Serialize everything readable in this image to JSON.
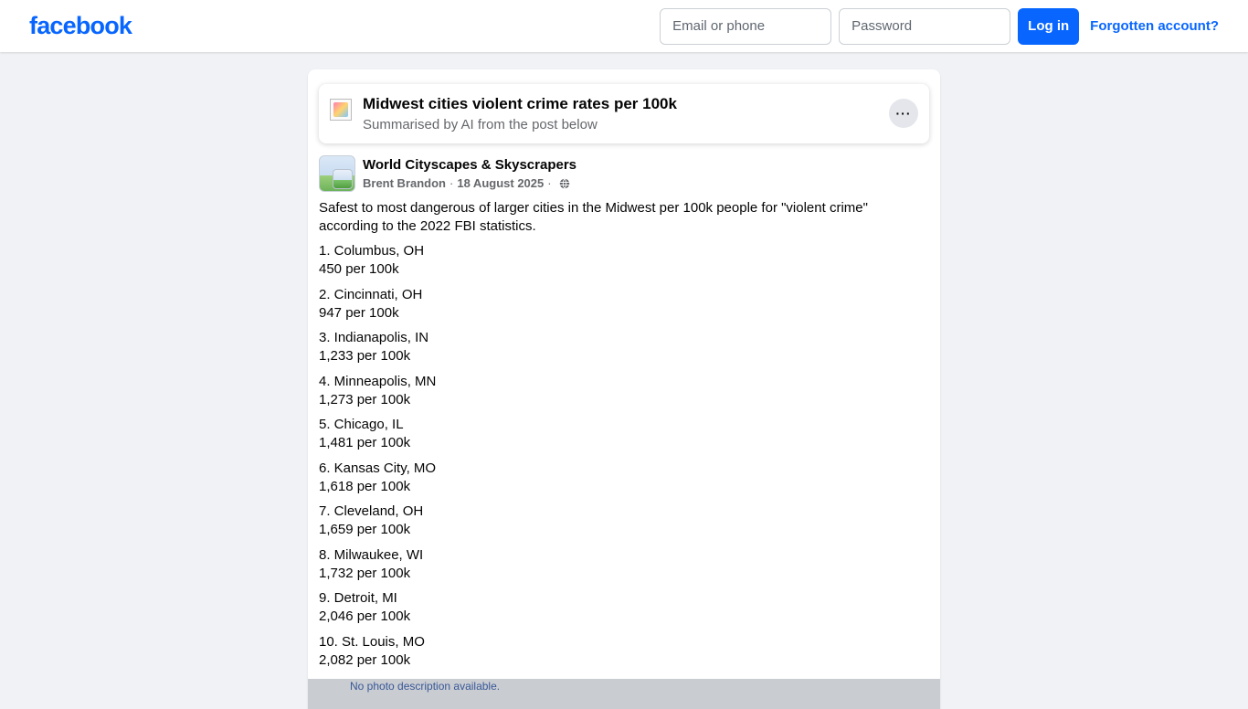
{
  "header": {
    "logo": "facebook",
    "email_placeholder": "Email or phone",
    "password_placeholder": "Password",
    "login_label": "Log in",
    "forgot_label": "Forgotten account?"
  },
  "summary": {
    "title": "Midwest cities violent crime rates per 100k",
    "subtitle": "Summarised by AI from the post below",
    "more_icon": "more-horizontal-icon",
    "more_label": "···"
  },
  "post": {
    "page_name": "World Cityscapes & Skyscrapers",
    "author": "Brent Brandon",
    "date": "18 August 2025",
    "privacy_icon": "globe-icon",
    "intro": "Safest to most dangerous of larger cities in the Midwest per 100k people for \"violent crime\" according to the 2022 FBI statistics.",
    "items": [
      {
        "city": "1. Columbus, OH",
        "rate": "450 per 100k"
      },
      {
        "city": "2. Cincinnati, OH",
        "rate": "947 per 100k"
      },
      {
        "city": "3. Indianapolis, IN",
        "rate": "1,233 per 100k"
      },
      {
        "city": "4. Minneapolis, MN",
        "rate": "1,273 per 100k"
      },
      {
        "city": "5. Chicago, IL",
        "rate": "1,481 per 100k"
      },
      {
        "city": "6. Kansas City, MO",
        "rate": "1,618 per 100k"
      },
      {
        "city": "7. Cleveland, OH",
        "rate": "1,659 per 100k"
      },
      {
        "city": "8. Milwaukee, WI",
        "rate": "1,732 per 100k"
      },
      {
        "city": "9. Detroit, MI",
        "rate": "2,046 per 100k"
      },
      {
        "city": "10. St. Louis, MO",
        "rate": "2,082 per 100k"
      }
    ],
    "photo_alt": "No photo description available."
  },
  "colors": {
    "brand": "#0866ff",
    "page_bg": "#f0f2f5",
    "secondary_text": "#65676b"
  }
}
